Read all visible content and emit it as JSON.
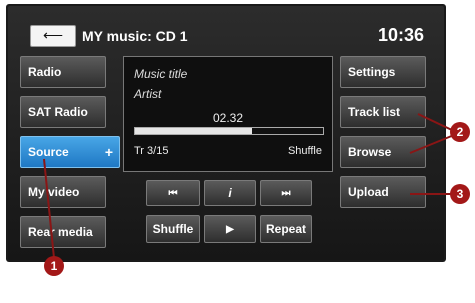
{
  "header": {
    "back_symbol": "⟵",
    "title": "MY music: CD 1",
    "clock": "10:36"
  },
  "left_menu": [
    {
      "label": "Radio",
      "active": false
    },
    {
      "label": "SAT Radio",
      "active": false
    },
    {
      "label": "Source",
      "active": true,
      "suffix": "+"
    },
    {
      "label": "My video",
      "active": false
    },
    {
      "label": "Rear media",
      "active": false
    }
  ],
  "right_menu": [
    {
      "label": "Settings"
    },
    {
      "label": "Track list"
    },
    {
      "label": "Browse"
    },
    {
      "label": "Upload"
    }
  ],
  "now_playing": {
    "title": "Music title",
    "artist": "Artist",
    "time": "02.32",
    "progress": 0.62,
    "track": "Tr 3/15",
    "mode": "Shuffle"
  },
  "transport": {
    "prev": "⏮",
    "info": "i",
    "next": "⏭",
    "shuffle": "Shuffle",
    "play": "▶",
    "repeat": "Repeat"
  },
  "callouts": [
    "1",
    "2",
    "3"
  ]
}
